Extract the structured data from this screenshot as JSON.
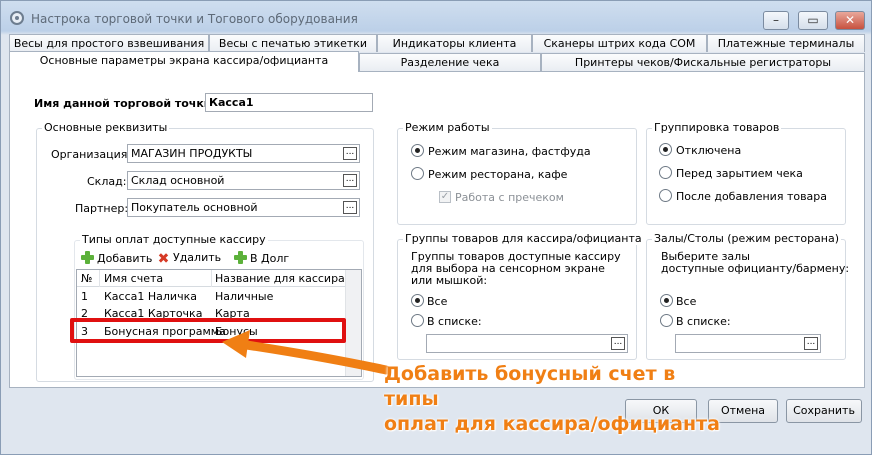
{
  "window": {
    "title": "Настрока торговой точки и Тогового оборудования"
  },
  "tabs": {
    "row1": [
      "Весы для простого взвешивания",
      "Весы с печатью этикетки",
      "Индикаторы клиента",
      "Сканеры штрих кода COM",
      "Платежные терминалы"
    ],
    "row2": [
      "Основные параметры экрана кассира/официанта",
      "Разделение чека",
      "Принтеры чеков/Фискальные регистраторы"
    ],
    "active": "Основные параметры экрана кассира/официанта"
  },
  "point": {
    "label": "Имя данной торговой точки:",
    "value": "Касса1"
  },
  "requisites": {
    "title": "Основные реквизиты",
    "org_label": "Организация:",
    "org_value": "МАГАЗИН ПРОДУКТЫ",
    "warehouse_label": "Склад:",
    "warehouse_value": "Склад основной",
    "partner_label": "Партнер:",
    "partner_value": "Покупатель основной"
  },
  "payments": {
    "title": "Типы оплат доступные кассиру",
    "add": "Добавить",
    "delete": "Удалить",
    "debt": "В Долг",
    "columns": [
      "№",
      "Имя счета",
      "Название для кассира"
    ],
    "rows": [
      [
        "1",
        "Касса1 Наличка",
        "Наличные"
      ],
      [
        "2",
        "Касса1 Карточка",
        "Карта"
      ],
      [
        "3",
        "Бонусная программа",
        "Бонусы"
      ]
    ]
  },
  "mode": {
    "title": "Режим работы",
    "shop": "Режим магазина, фастфуда",
    "restaurant": "Режим ресторана, кафе",
    "receipt": "Работа с пречеком",
    "selected": "shop"
  },
  "grouping": {
    "title": "Группировка товаров",
    "off": "Отключена",
    "before_close": "Перед зарытием чека",
    "after_add": "После добавления товара",
    "selected": "off"
  },
  "product_groups": {
    "title": "Группы товаров для кассира/официанта",
    "hint": [
      "Группы товаров доступные кассиру",
      "для выбора на сенсорном экране",
      "или мышкой:"
    ],
    "all": "Все",
    "list": "В списке:",
    "selected": "all"
  },
  "halls": {
    "title": "Залы/Столы (режим ресторана)",
    "hint": [
      "Выберите залы",
      "доступные официанту/бармену:"
    ],
    "all": "Все",
    "list": "В списке:",
    "selected": "all"
  },
  "buttons": {
    "ok": "ОК",
    "cancel": "Отмена",
    "save": "Сохранить"
  },
  "annotation": {
    "line1": "Добавить бонусный счет в типы",
    "line2": "оплат для кассира/официанта"
  },
  "colors": {
    "highlight": "#e01010",
    "annotation": "#f07f14"
  }
}
